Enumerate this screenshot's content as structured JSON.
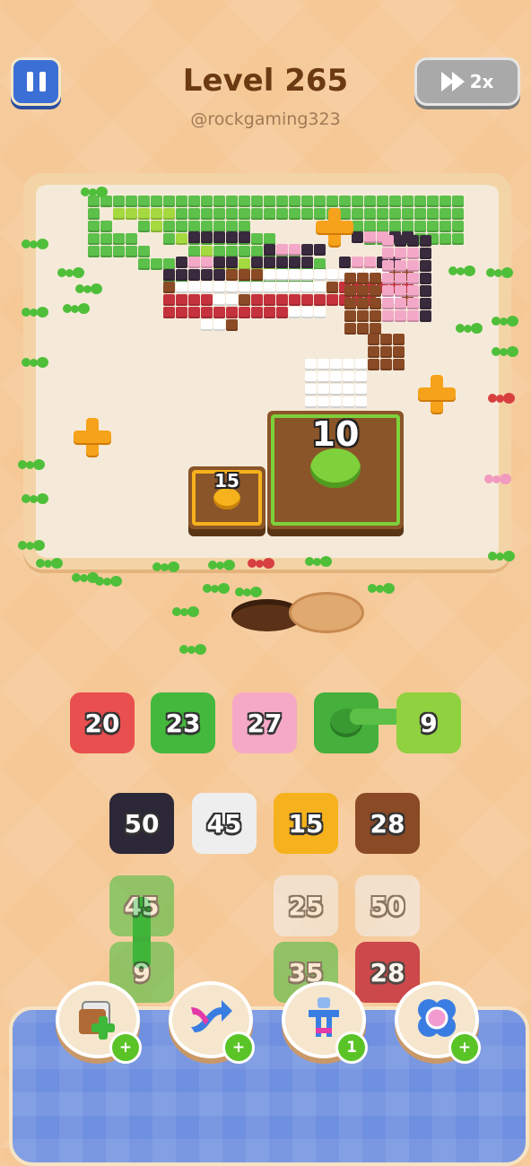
{
  "header": {
    "level_title": "Level 265",
    "username": "@rockgaming323",
    "speed_label": "2x"
  },
  "board": {
    "crates": [
      {
        "count": "10",
        "size": "large"
      },
      {
        "count": "15",
        "size": "small"
      }
    ],
    "bonus_icons": [
      "plus-icon",
      "plus-icon",
      "plus-icon"
    ]
  },
  "blocks": {
    "row1": [
      {
        "value": "20",
        "color": "#e94f4f"
      },
      {
        "value": "23",
        "color": "#44b83c"
      },
      {
        "value": "27",
        "color": "#f5a9c6"
      },
      {
        "value": "",
        "color": "#45b03b"
      },
      {
        "value": "9",
        "color": "#8fd13f"
      }
    ],
    "row2": [
      {
        "value": "50",
        "color": "#2c2838"
      },
      {
        "value": "45",
        "color": "#eeeeee"
      },
      {
        "value": "15",
        "color": "#f6b21c"
      },
      {
        "value": "28",
        "color": "#8a4a25"
      }
    ],
    "row3": [
      {
        "value": "45",
        "color": "#4fc04a"
      },
      {
        "value": "25",
        "color": "#ececec"
      },
      {
        "value": "50",
        "color": "#ececec"
      }
    ],
    "row4": [
      {
        "value": "9",
        "color": "#4fc04a"
      },
      {
        "value": "35",
        "color": "#4fc04a"
      },
      {
        "value": "28",
        "color": "#d3323e"
      }
    ]
  },
  "powerups": [
    {
      "name": "add-slot-powerup",
      "badge": "+"
    },
    {
      "name": "shuffle-powerup",
      "badge": "+"
    },
    {
      "name": "magnet-powerup",
      "badge": "1"
    },
    {
      "name": "freeze-powerup",
      "badge": "+"
    }
  ],
  "colors": {
    "background": "#f5c896",
    "tray": "#6f8fe0",
    "accent_green": "#5ac427"
  }
}
